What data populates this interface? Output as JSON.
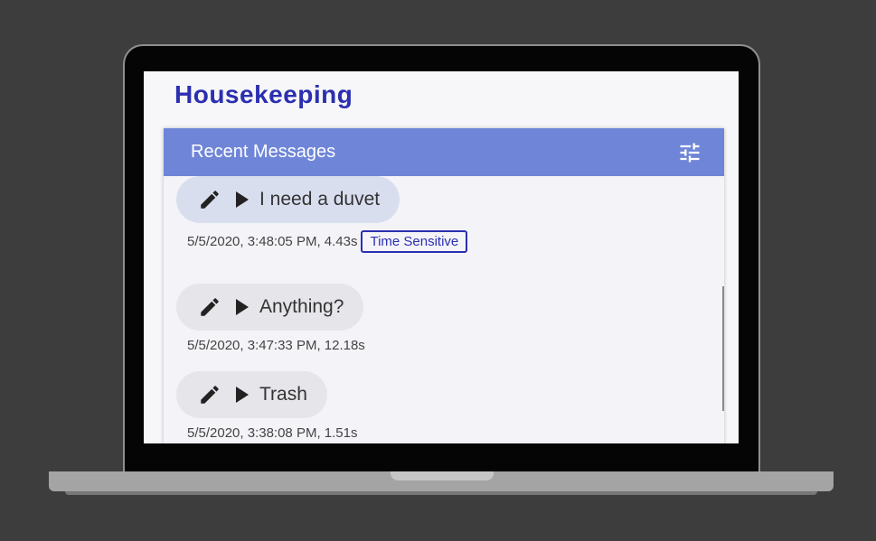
{
  "app": {
    "title": "Housekeeping"
  },
  "panel": {
    "title": "Recent Messages",
    "filter_icon": "tune-icon"
  },
  "messages": [
    {
      "text": "I need a duvet",
      "meta": "5/5/2020, 3:48:05 PM, 4.43s",
      "tag": "Time Sensitive",
      "selected": true
    },
    {
      "text": "Anything?",
      "meta": "5/5/2020, 3:47:33 PM, 12.18s",
      "tag": null,
      "selected": false
    },
    {
      "text": "Trash",
      "meta": "5/5/2020, 3:38:08 PM, 1.51s",
      "tag": null,
      "selected": false
    }
  ],
  "colors": {
    "accent": "#2b2fb0",
    "header": "#6f85d8",
    "selected_bubble": "#d9deef",
    "bubble": "#e6e6ea"
  },
  "icons": {
    "edit": "pencil-icon",
    "play": "play-icon"
  }
}
